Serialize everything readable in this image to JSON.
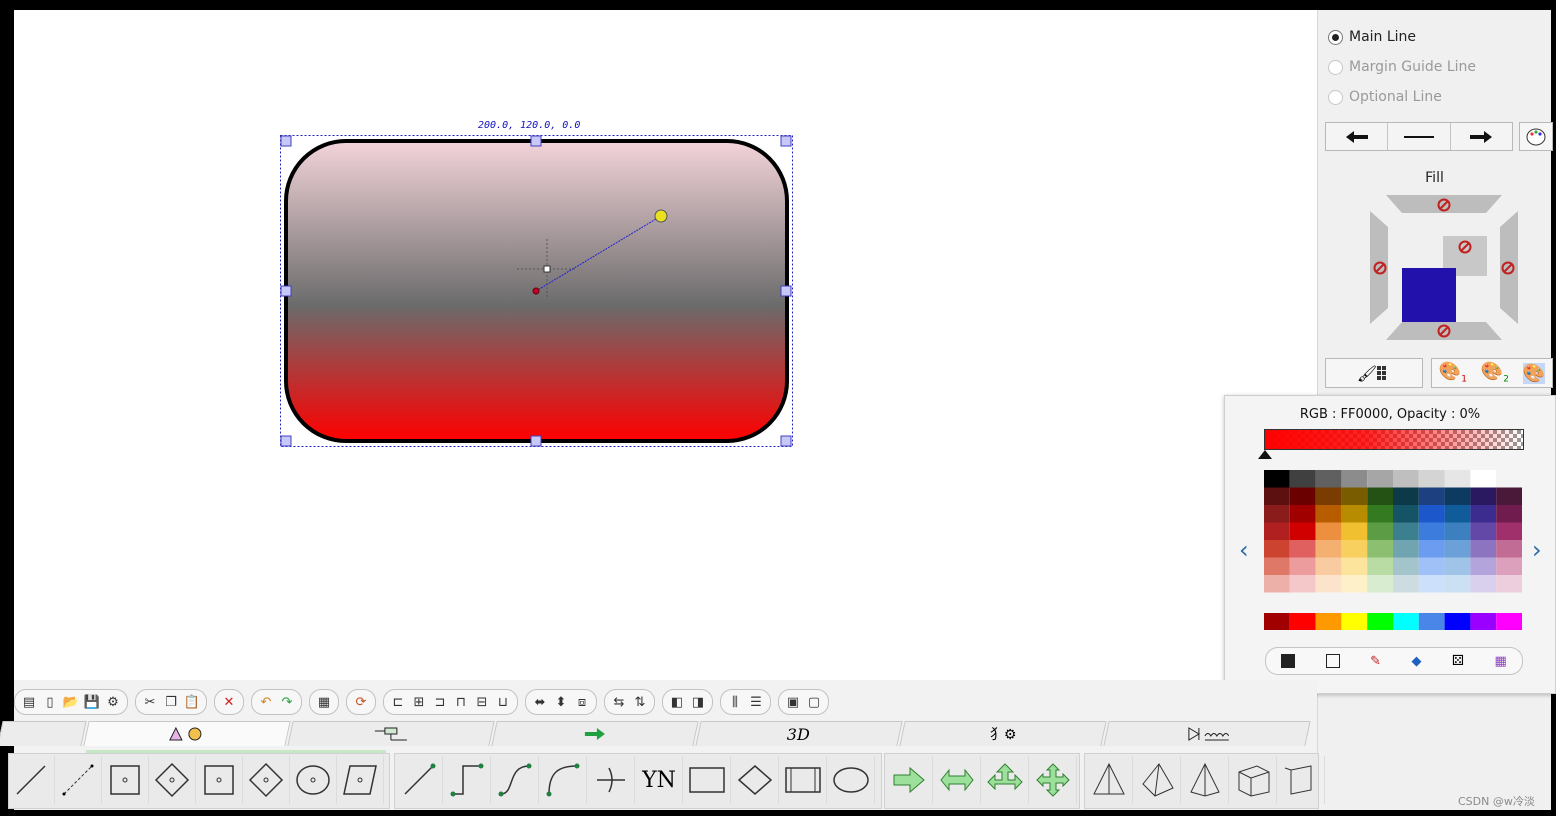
{
  "canvas": {
    "selection_readout": "200.0, 120.0, 0.0",
    "gradient": {
      "top_color": "#f3d4da",
      "middle_color": "#6b6b6b",
      "bottom_color": "#ff0000"
    }
  },
  "line_style_panel": {
    "options": [
      {
        "label": "Main Line",
        "selected": true,
        "enabled": true
      },
      {
        "label": "Margin Guide Line",
        "selected": false,
        "enabled": false
      },
      {
        "label": "Optional Line",
        "selected": false,
        "enabled": false
      }
    ],
    "direction_buttons": [
      "arrow-left-icon",
      "line-icon",
      "arrow-right-icon"
    ],
    "fill_label": "Fill",
    "fill_color": "#2211aa"
  },
  "color_popup": {
    "readout": "RGB : FF0000, Opacity : 0%",
    "current_color": "#ff0000",
    "grid": [
      [
        "#000000",
        "#404040",
        "#606060",
        "#8c8c8c",
        "#a6a6a6",
        "#bfbfbf",
        "#d4d4d4",
        "#e6e6e6",
        "#ffffff",
        "#f4f4f4"
      ],
      [
        "#5c1010",
        "#6a0000",
        "#7a3c00",
        "#7a5c00",
        "#245214",
        "#0c3a48",
        "#1c4080",
        "#0c3a60",
        "#2a1860",
        "#4a1838"
      ],
      [
        "#8a1c1c",
        "#a00000",
        "#b85c00",
        "#b88c00",
        "#347a20",
        "#145466",
        "#1c58cc",
        "#105c9a",
        "#3c2c90",
        "#701c4e"
      ],
      [
        "#b02020",
        "#d00000",
        "#ec9040",
        "#f0c030",
        "#5c9c44",
        "#3c8090",
        "#3c7cdc",
        "#3c80c0",
        "#6448a8",
        "#a0306c"
      ],
      [
        "#cc4430",
        "#e06060",
        "#f4b070",
        "#f8d060",
        "#8cc070",
        "#70a4b0",
        "#6c9cf0",
        "#6ca0d8",
        "#8c74c0",
        "#c06c94"
      ],
      [
        "#e07868",
        "#ec9c9c",
        "#f8ccA0",
        "#fce49c",
        "#b8dca4",
        "#a4c4cc",
        "#a0c0f8",
        "#a0c4e8",
        "#b4a4dc",
        "#dca0bc"
      ],
      [
        "#ecb0a8",
        "#f4c8c8",
        "#fce4cc",
        "#fef0c8",
        "#d8ecd0",
        "#ccdce0",
        "#cce0fc",
        "#cce0f4",
        "#d8d0ec",
        "#eccedc"
      ]
    ],
    "standard_row": [
      "#a00000",
      "#ff0000",
      "#ff9900",
      "#ffff00",
      "#00ff00",
      "#00ffff",
      "#4a86e8",
      "#0000ff",
      "#9900ff",
      "#ff00ff"
    ],
    "tools": [
      "square-fill-icon",
      "square-outline-icon",
      "eyedropper-icon",
      "paint-bucket-icon",
      "dice-icon",
      "palette-grid-icon"
    ]
  },
  "toolbar": {
    "groups": [
      [
        "menu-icon",
        "new-icon",
        "open-icon",
        "save-icon",
        "settings-icon"
      ],
      [
        "cut-icon",
        "copy-icon",
        "paste-icon"
      ],
      [
        "delete-icon"
      ],
      [
        "undo-icon",
        "redo-icon"
      ],
      [
        "grid-icon"
      ],
      [
        "rotate-icon"
      ],
      [
        "align-left-icon",
        "align-center-icon",
        "align-right-icon",
        "align-top-icon",
        "align-middle-icon",
        "align-bottom-icon"
      ],
      [
        "same-width-icon",
        "same-height-icon",
        "same-size-icon"
      ],
      [
        "flip-h-icon",
        "flip-v-icon"
      ],
      [
        "bring-front-icon",
        "send-back-icon"
      ],
      [
        "distribute-h-icon",
        "distribute-v-icon"
      ],
      [
        "group-icon",
        "ungroup-icon"
      ]
    ]
  },
  "tabs": [
    {
      "label": "",
      "icon": "blank-tab"
    },
    {
      "label": "",
      "icon": "triangle-circle-icon",
      "active": true
    },
    {
      "label": "",
      "icon": "connector-icon"
    },
    {
      "label": "",
      "icon": "green-arrow-icon"
    },
    {
      "label": "3D",
      "icon": ""
    },
    {
      "label": "",
      "icon": "misc-gear-icon"
    },
    {
      "label": "",
      "icon": "electrical-icon"
    }
  ],
  "shapes": {
    "basic": [
      "line-icon",
      "dashed-line-icon",
      "rect-point-icon",
      "diamond-point-icon",
      "rect-edge-icon",
      "diamond-edge-icon",
      "circle-point-icon",
      "parallelogram-point-icon"
    ],
    "flow": [
      "arrow-line-icon",
      "elbow-line-icon",
      "curve-line-icon",
      "s-curve-icon",
      "branch-icon"
    ],
    "flow_text": "YN",
    "flow_shapes": [
      "rectangle-icon",
      "diamond-icon",
      "process-icon",
      "ellipse-icon"
    ],
    "arrows": [
      "right-arrow-icon",
      "double-arrow-icon",
      "three-way-arrow-icon",
      "four-way-arrow-icon"
    ],
    "solids": [
      "cone-icon",
      "pyramid-icon",
      "tetra-icon",
      "cube-icon",
      "box-icon"
    ]
  },
  "watermark": "CSDN @w冷淡"
}
